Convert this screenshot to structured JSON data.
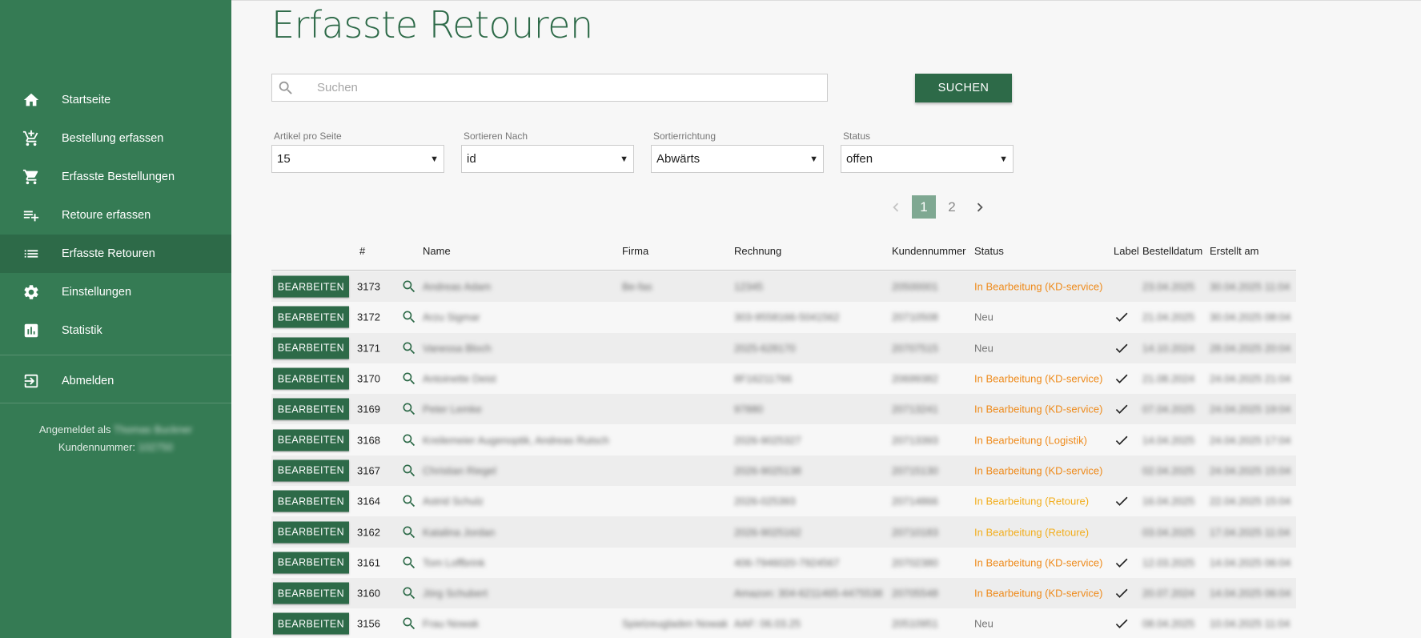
{
  "colors": {
    "primary": "#2d6a48",
    "sidebar_bg": "#357b54",
    "status_orange": "#ee8a1a",
    "status_yellow": "#f2ae1e",
    "status_grey": "#777777"
  },
  "sidebar": {
    "items": [
      {
        "label": "Startseite",
        "icon": "home-icon"
      },
      {
        "label": "Bestellung erfassen",
        "icon": "add-shopping-cart-icon"
      },
      {
        "label": "Erfasste Bestellungen",
        "icon": "shopping-cart-icon"
      },
      {
        "label": "Retoure erfassen",
        "icon": "playlist-add-icon"
      },
      {
        "label": "Erfasste Retouren",
        "icon": "list-icon",
        "active": true
      },
      {
        "label": "Einstellungen",
        "icon": "gear-icon"
      },
      {
        "label": "Statistik",
        "icon": "chart-icon"
      }
    ],
    "logout_label": "Abmelden",
    "logged_in_label": "Angemeldet als",
    "logged_in_user": "Thomas Buckner",
    "customer_label": "Kundennummer:",
    "customer_number": "102750"
  },
  "main": {
    "title": "Erfasste Retouren",
    "search_placeholder": "Suchen",
    "search_button": "SUCHEN",
    "filters": [
      {
        "label": "Artikel pro Seite",
        "value": "15"
      },
      {
        "label": "Sortieren Nach",
        "value": "id"
      },
      {
        "label": "Sortierrichtung",
        "value": "Abwärts"
      },
      {
        "label": "Status",
        "value": "offen"
      }
    ],
    "pagination": {
      "pages": [
        "1",
        "2"
      ],
      "current": "1"
    }
  },
  "table": {
    "headers": {
      "id": "#",
      "name": "Name",
      "firma": "Firma",
      "rechnung": "Rechnung",
      "kundennummer": "Kundennummer",
      "status": "Status",
      "label": "Label",
      "bestelldatum": "Bestelldatum",
      "erstellt": "Erstellt am"
    },
    "edit_label": "BEARBEITEN",
    "rows": [
      {
        "id": "3173",
        "name": "Andreas Adam",
        "firma": "Be-fas",
        "rechnung": "12345",
        "kd": "20500001",
        "status": "In Bearbeitung (KD-service)",
        "status_type": "orange",
        "label": false,
        "bd": "23.04.2025",
        "er": "30.04.2025 11:04"
      },
      {
        "id": "3172",
        "name": "Arzu Sigmar",
        "firma": "",
        "rechnung": "303-9558166-5041562",
        "kd": "20710508",
        "status": "Neu",
        "status_type": "grey",
        "label": true,
        "bd": "21.04.2025",
        "er": "30.04.2025 08:04"
      },
      {
        "id": "3171",
        "name": "Vanessa Bloch",
        "firma": "",
        "rechnung": "2025-628170",
        "kd": "20707515",
        "status": "Neu",
        "status_type": "grey",
        "label": true,
        "bd": "14.10.2024",
        "er": "28.04.2025 20:04"
      },
      {
        "id": "3170",
        "name": "Antoinette Deist",
        "firma": "",
        "rechnung": "8F16211766",
        "kd": "20699382",
        "status": "In Bearbeitung (KD-service)",
        "status_type": "orange",
        "label": true,
        "bd": "21.08.2024",
        "er": "24.04.2025 21:04"
      },
      {
        "id": "3169",
        "name": "Peter Lemke",
        "firma": "",
        "rechnung": "97880",
        "kd": "20713241",
        "status": "In Bearbeitung (KD-service)",
        "status_type": "orange",
        "label": true,
        "bd": "07.04.2025",
        "er": "24.04.2025 19:04"
      },
      {
        "id": "3168",
        "name": "Kreilemeier Augenoptik, Andreas Rutsch",
        "firma": "",
        "rechnung": "2026-9025327",
        "kd": "20713393",
        "status": "In Bearbeitung (Logistik)",
        "status_type": "orange",
        "label": true,
        "bd": "14.04.2025",
        "er": "24.04.2025 17:04"
      },
      {
        "id": "3167",
        "name": "Christian Riegel",
        "firma": "",
        "rechnung": "2026-9025138",
        "kd": "20715130",
        "status": "In Bearbeitung (KD-service)",
        "status_type": "orange",
        "label": false,
        "bd": "02.04.2025",
        "er": "24.04.2025 15:04"
      },
      {
        "id": "3164",
        "name": "Astrid Schulz",
        "firma": "",
        "rechnung": "2026-025393",
        "kd": "20714866",
        "status": "In Bearbeitung (Retoure)",
        "status_type": "yellow",
        "label": true,
        "bd": "16.04.2025",
        "er": "22.04.2025 15:04"
      },
      {
        "id": "3162",
        "name": "Katalina Jordan",
        "firma": "",
        "rechnung": "2026-9025162",
        "kd": "20710183",
        "status": "In Bearbeitung (Retoure)",
        "status_type": "yellow",
        "label": false,
        "bd": "03.04.2025",
        "er": "17.04.2025 11:04"
      },
      {
        "id": "3161",
        "name": "Tom Loffbrink",
        "firma": "",
        "rechnung": "406-7946020-7924567",
        "kd": "20702380",
        "status": "In Bearbeitung (KD-service)",
        "status_type": "orange",
        "label": true,
        "bd": "12.03.2025",
        "er": "14.04.2025 06:04"
      },
      {
        "id": "3160",
        "name": "Jörg Schubert",
        "firma": "",
        "rechnung": "Amazon: 304-6211465-4475538",
        "kd": "20705548",
        "status": "In Bearbeitung (KD-service)",
        "status_type": "orange",
        "label": true,
        "bd": "20.07.2024",
        "er": "14.04.2025 06:04"
      },
      {
        "id": "3156",
        "name": "Frau Nowak",
        "firma": "Spielzeugladen Nowak",
        "rechnung": "AAF: 06.03.25",
        "kd": "20510951",
        "status": "Neu",
        "status_type": "grey",
        "label": true,
        "bd": "08.04.2025",
        "er": "10.04.2025 11:04"
      }
    ]
  }
}
